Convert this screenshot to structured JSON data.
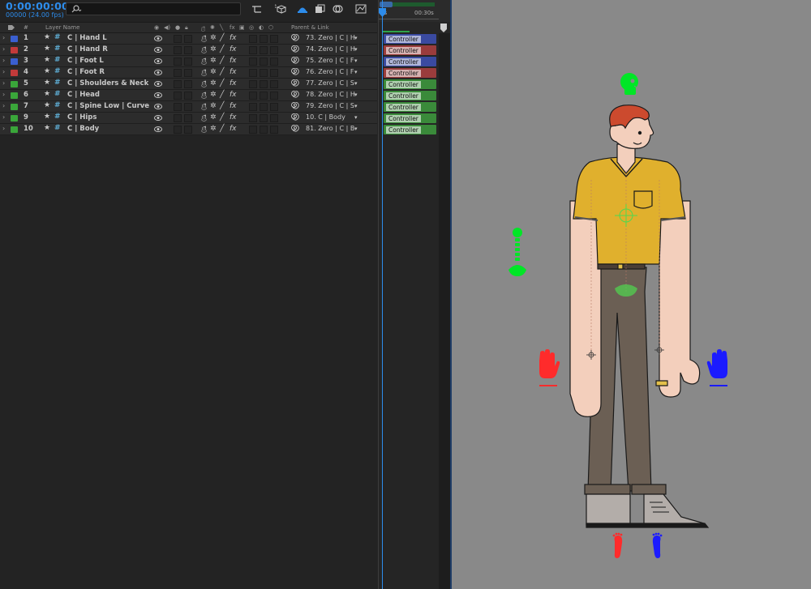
{
  "header": {
    "timecode": "0:00:00:00",
    "fps": "00000 (24.00 fps)",
    "search_placeholder": ""
  },
  "columns": {
    "number": "#",
    "layer_name": "Layer Name",
    "parent_link": "Parent & Link"
  },
  "layers": [
    {
      "num": "1",
      "name": "C | Hand L",
      "color": "#3a5fd0",
      "parent": "73. Zero | C | H",
      "track_label": "Controller",
      "track_color": "#3a4aa0"
    },
    {
      "num": "2",
      "name": "C | Hand R",
      "color": "#c23a3a",
      "parent": "74. Zero | C | H",
      "track_label": "Controller",
      "track_color": "#9a3c3c"
    },
    {
      "num": "3",
      "name": "C | Foot L",
      "color": "#3a5fd0",
      "parent": "75. Zero | C | F",
      "track_label": "Controller",
      "track_color": "#3a4aa0"
    },
    {
      "num": "4",
      "name": "C | Foot R",
      "color": "#c23a3a",
      "parent": "76. Zero | C | F",
      "track_label": "Controller",
      "track_color": "#9a3c3c"
    },
    {
      "num": "5",
      "name": "C | Shoulders & Neck",
      "color": "#3aa63a",
      "parent": "77. Zero | C | S",
      "track_label": "Controller",
      "track_color": "#3a8a3a"
    },
    {
      "num": "6",
      "name": "C | Head",
      "color": "#3aa63a",
      "parent": "78. Zero | C | H",
      "track_label": "Controller",
      "track_color": "#3a8a3a"
    },
    {
      "num": "7",
      "name": "C | Spine Low | Curve",
      "color": "#3aa63a",
      "parent": "79. Zero | C | S",
      "track_label": "Controller",
      "track_color": "#3a8a3a"
    },
    {
      "num": "9",
      "name": "C | Hips",
      "color": "#3aa63a",
      "parent": "10. C | Body",
      "track_label": "Controller",
      "track_color": "#3a8a3a"
    },
    {
      "num": "10",
      "name": "C | Body",
      "color": "#3aa63a",
      "parent": "81. Zero | C | B",
      "track_label": "Controller",
      "track_color": "#3a8a3a"
    }
  ],
  "ruler": {
    "start": "0s",
    "end": "00:30s"
  },
  "colors": {
    "accent_blue": "#2d8ceb",
    "controller_green": "#00ff2a",
    "controller_red": "#ff2b2b",
    "controller_blue": "#1b1bff"
  }
}
